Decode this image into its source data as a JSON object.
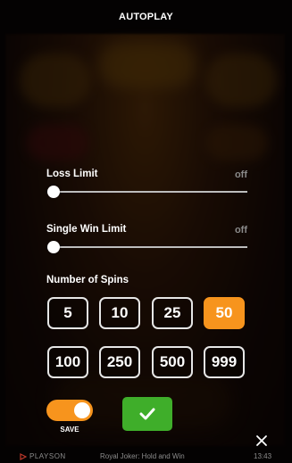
{
  "header": {
    "title": "AUTOPLAY"
  },
  "loss_limit": {
    "label": "Loss Limit",
    "value": "off",
    "level": 0
  },
  "single_win_limit": {
    "label": "Single Win Limit",
    "value": "off",
    "level": 0
  },
  "spins": {
    "label": "Number of Spins",
    "options": [
      "5",
      "10",
      "25",
      "50",
      "100",
      "250",
      "500",
      "999"
    ],
    "selected": "50"
  },
  "save": {
    "label": "SAVE",
    "enabled": true
  },
  "colors": {
    "accent": "#f7941d",
    "confirm": "#3fae2a"
  },
  "icons": {
    "confirm": "checkmark-icon",
    "close": "close-icon",
    "brand": "playson-logo-icon"
  },
  "footer": {
    "brand": "PLAYSON",
    "game": "Royal Joker: Hold and Win",
    "time": "13:43"
  }
}
